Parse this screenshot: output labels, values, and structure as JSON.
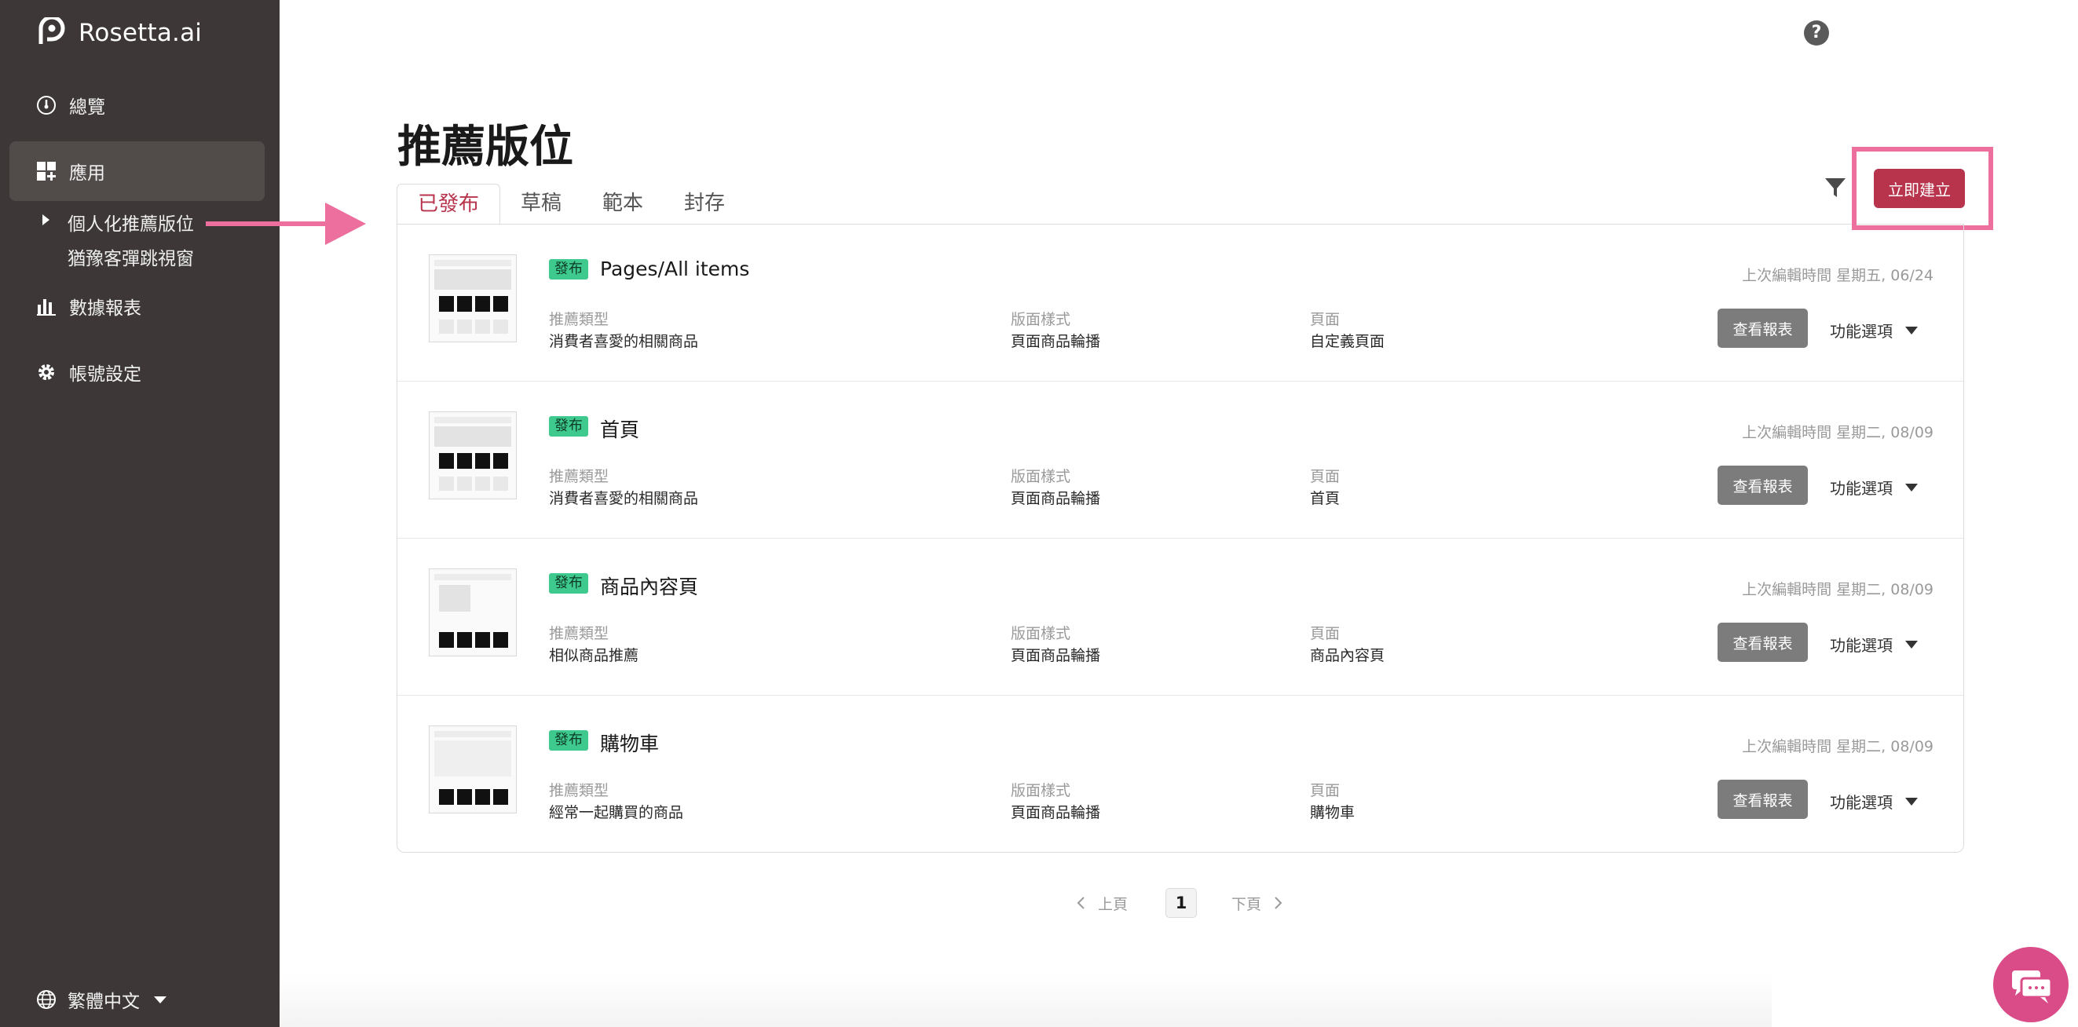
{
  "app": {
    "name": "Rosetta.ai"
  },
  "sidebar": {
    "items": [
      {
        "label": "總覽",
        "icon": "gauge-icon"
      },
      {
        "label": "應用",
        "icon": "apps-icon"
      },
      {
        "label": "數據報表",
        "icon": "bar-chart-icon"
      },
      {
        "label": "帳號設定",
        "icon": "gear-icon"
      }
    ],
    "subitems": [
      {
        "label": "個人化推薦版位"
      },
      {
        "label": "猶豫客彈跳視窗"
      }
    ],
    "language": "繁體中文"
  },
  "header": {
    "help": "?"
  },
  "page": {
    "title": "推薦版位"
  },
  "tabs": [
    {
      "label": "已發布"
    },
    {
      "label": "草稿"
    },
    {
      "label": "範本"
    },
    {
      "label": "封存"
    }
  ],
  "toolbar": {
    "create_label": "立即建立"
  },
  "meta_labels": {
    "type": "推薦類型",
    "style": "版面樣式",
    "page": "頁面"
  },
  "list": [
    {
      "badge": "發布",
      "title": "Pages/All items",
      "edited": "上次編輯時間 星期五, 06/24",
      "type": "消費者喜愛的相關商品",
      "style": "頁面商品輪播",
      "page": "自定義頁面",
      "report_label": "查看報表",
      "func_label": "功能選項"
    },
    {
      "badge": "發布",
      "title": "首頁",
      "edited": "上次編輯時間 星期二, 08/09",
      "type": "消費者喜愛的相關商品",
      "style": "頁面商品輪播",
      "page": "首頁",
      "report_label": "查看報表",
      "func_label": "功能選項"
    },
    {
      "badge": "發布",
      "title": "商品內容頁",
      "edited": "上次編輯時間 星期二, 08/09",
      "type": "相似商品推薦",
      "style": "頁面商品輪播",
      "page": "商品內容頁",
      "report_label": "查看報表",
      "func_label": "功能選項"
    },
    {
      "badge": "發布",
      "title": "購物車",
      "edited": "上次編輯時間 星期二, 08/09",
      "type": "經常一起購買的商品",
      "style": "頁面商品輪播",
      "page": "購物車",
      "report_label": "查看報表",
      "func_label": "功能選項"
    }
  ],
  "pagination": {
    "prev": "上頁",
    "current": "1",
    "next": "下頁"
  },
  "colors": {
    "sidebar": "#3d3837",
    "accent": "#b7344c",
    "badge": "#3ec98e",
    "highlight": "#ec6f9d"
  }
}
